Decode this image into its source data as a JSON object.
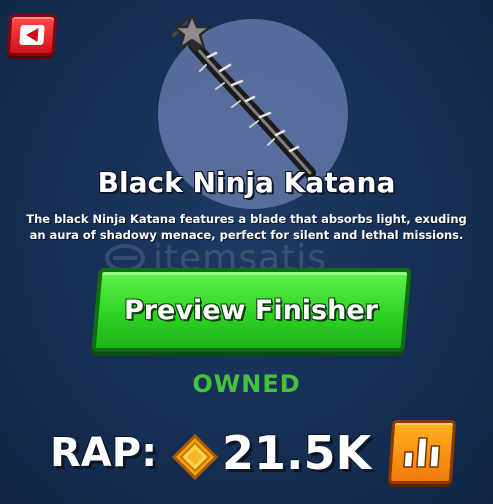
{
  "back_button": {
    "icon": "back-arrow-icon"
  },
  "item": {
    "name": "Black Ninja Katana",
    "description": "The black Ninja Katana features a blade that absorbs light, exuding an aura of shadowy menace, perfect for silent and lethal missions.",
    "icon": "katana-icon",
    "rarity_icon": "star-icon"
  },
  "watermark": {
    "text": "itemsatis"
  },
  "actions": {
    "preview_label": "Preview Finisher"
  },
  "status": {
    "label": "OWNED",
    "color": "#45c23c"
  },
  "rap": {
    "label": "RAP:",
    "value": "21.5K",
    "coin_icon": "coin-icon",
    "stats_icon": "bar-chart-icon"
  },
  "colors": {
    "background": "#173057",
    "back_button": "#e8202b",
    "preview_button": "#34d626",
    "stats_button": "#f59a14"
  }
}
